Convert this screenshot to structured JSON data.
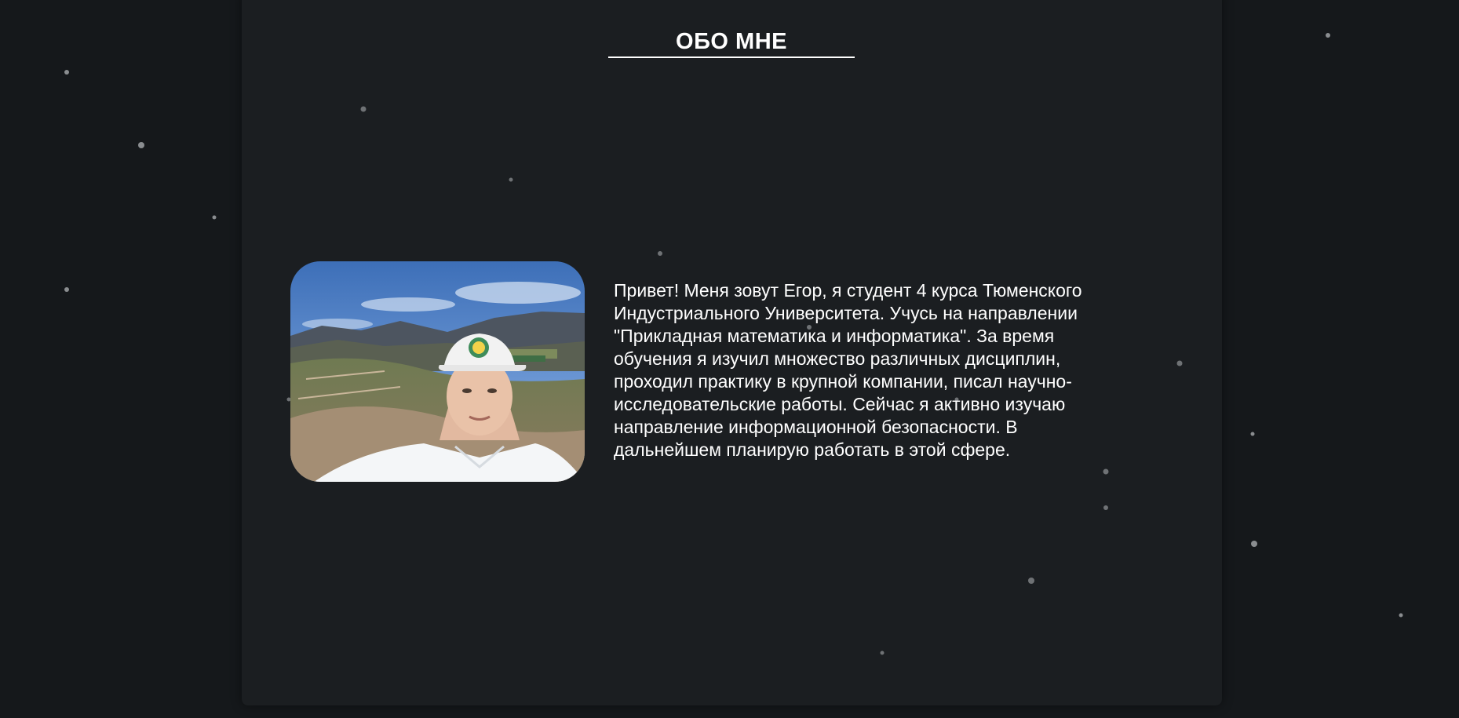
{
  "section": {
    "title": "ОБО МНЕ"
  },
  "about": {
    "text": "Привет! Меня зовут Егор, я студент 4 курса Тюменского\nИндустриального Университета. Учусь на направлении\n\"Прикладная математика и информатика\". За время\nобучения я изучил множество различных дисциплин,\nпроходил практику в крупной компании, писал научно-\nисследовательские работы. Сейчас я активно изучаю\nнаправление информационной безопасности. В\nдальнейшем планирую работать в этой сфере."
  },
  "colors": {
    "background": "#15181b",
    "card": "#1b1e21",
    "text": "#ffffff",
    "star": "#8a8d90"
  }
}
